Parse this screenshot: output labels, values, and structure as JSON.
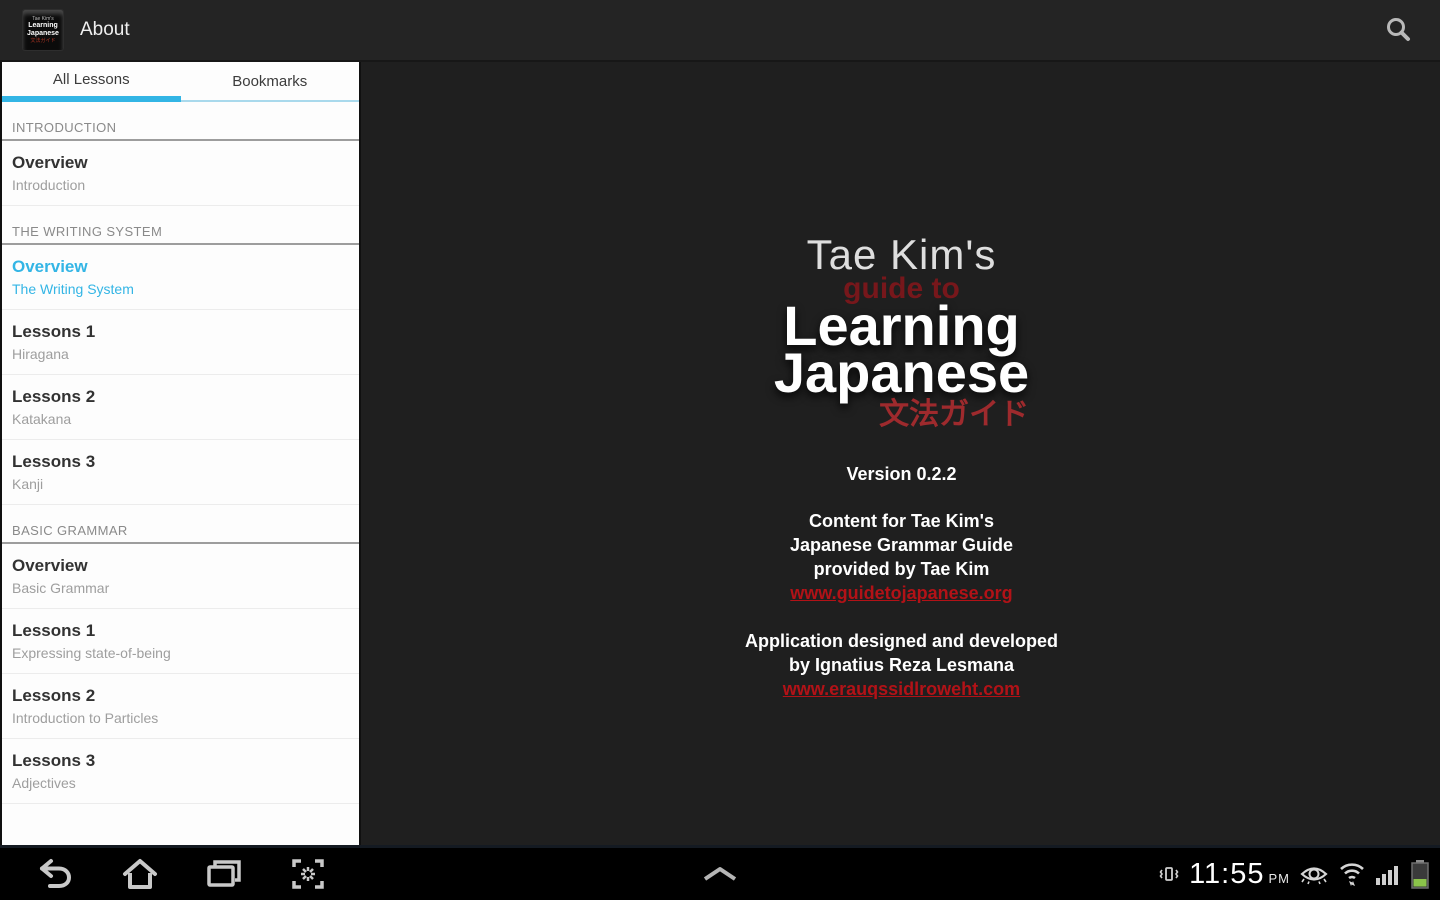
{
  "action_bar": {
    "title": "About"
  },
  "tabs": {
    "all_lessons": "All Lessons",
    "bookmarks": "Bookmarks"
  },
  "sidebar": {
    "sections": [
      {
        "header": "INTRODUCTION",
        "items": [
          {
            "title": "Overview",
            "subtitle": "Introduction"
          }
        ]
      },
      {
        "header": "THE WRITING SYSTEM",
        "items": [
          {
            "title": "Overview",
            "subtitle": "The Writing System",
            "selected": true
          },
          {
            "title": "Lessons 1",
            "subtitle": "Hiragana"
          },
          {
            "title": "Lessons 2",
            "subtitle": "Katakana"
          },
          {
            "title": "Lessons 3",
            "subtitle": "Kanji"
          }
        ]
      },
      {
        "header": "BASIC GRAMMAR",
        "items": [
          {
            "title": "Overview",
            "subtitle": "Basic Grammar"
          },
          {
            "title": "Lessons 1",
            "subtitle": "Expressing state-of-being"
          },
          {
            "title": "Lessons 2",
            "subtitle": "Introduction to Particles"
          },
          {
            "title": "Lessons 3",
            "subtitle": "Adjectives"
          }
        ]
      }
    ]
  },
  "about": {
    "logo": {
      "line1": "Tae Kim's",
      "line2": "guide to",
      "line3": "Learning",
      "line4": "Japanese",
      "line5": "文法ガイド"
    },
    "version": "Version 0.2.2",
    "content_line1": "Content for Tae Kim's",
    "content_line2": "Japanese Grammar Guide",
    "content_line3": "provided by Tae Kim",
    "content_link": "www.guidetojapanese.org",
    "dev_line1": "Application designed and developed",
    "dev_line2": "by Ignatius Reza Lesmana",
    "dev_link": "www.erauqssidlroweht.com"
  },
  "nav_bar": {
    "time": "11:55",
    "ampm": "PM"
  },
  "icons": {
    "search": "search-icon",
    "back": "back-icon",
    "home": "home-icon",
    "recents": "recent-apps-icon",
    "screenshot": "screenshot-icon",
    "chevron": "chevron-up-icon",
    "vibrate": "vibrate-icon",
    "smart_stay": "smart-stay-eye-icon",
    "wifi": "wifi-icon",
    "signal": "signal-strength-icon",
    "battery": "battery-icon"
  },
  "colors": {
    "accent_blue": "#33b5e5",
    "link_red": "#b21217",
    "logo_dark_red": "#77171b",
    "kanji_red": "#9e2a2d",
    "action_bar_bg": "#242424",
    "content_bg": "#1f1f1f",
    "sidebar_bg": "#fdfdfd",
    "nav_bar_bg": "#000000",
    "battery_green": "#8bc34a"
  }
}
